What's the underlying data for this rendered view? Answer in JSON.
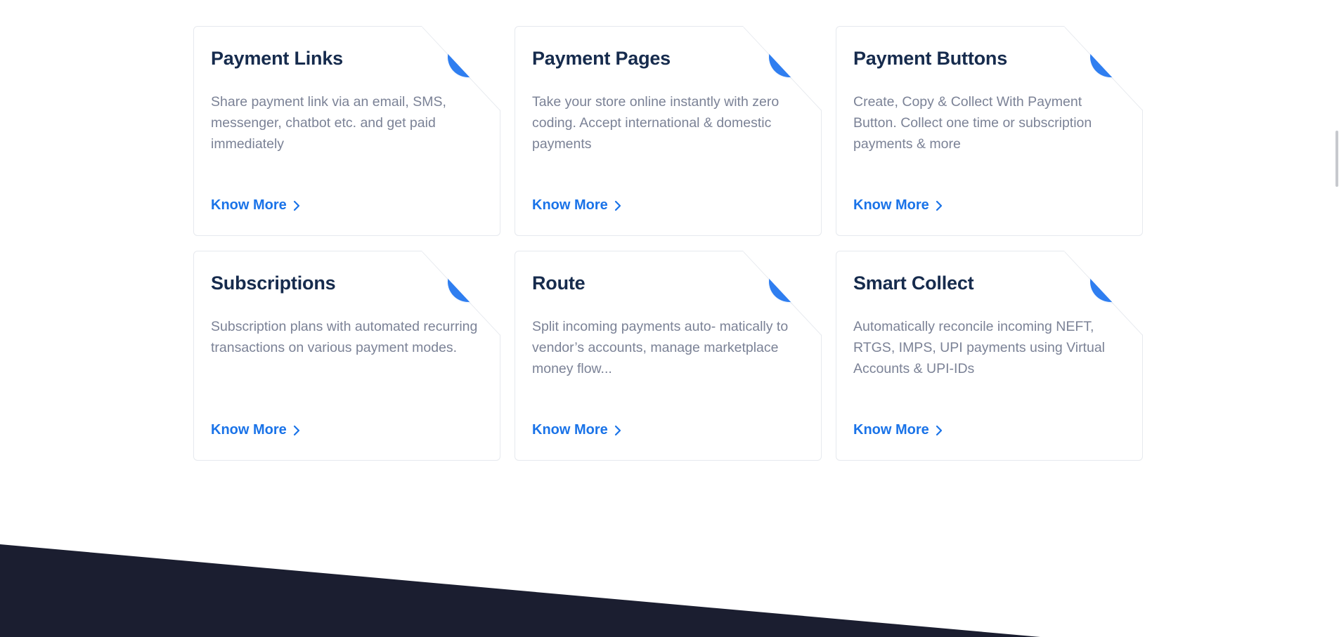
{
  "cards": [
    {
      "title": "Payment Links",
      "description": "Share payment link via an email, SMS, messenger, chatbot etc. and get paid immediately",
      "link_label": "Know More",
      "icon": "payment-links-icon"
    },
    {
      "title": "Payment Pages",
      "description": "Take your store online instantly with zero coding. Accept international & domestic payments",
      "link_label": "Know More",
      "icon": "payment-pages-icon"
    },
    {
      "title": "Payment Buttons",
      "description": "Create, Copy & Collect With Payment Button. Collect one time or subscription payments & more",
      "link_label": "Know More",
      "icon": "payment-buttons-icon"
    },
    {
      "title": "Subscriptions",
      "description": "Subscription plans with automated recurring transactions on various payment modes.",
      "link_label": "Know More",
      "icon": "rupee-refresh-icon"
    },
    {
      "title": "Route",
      "description": "Split incoming payments auto- matically to vendor’s accounts, manage marketplace money flow...",
      "link_label": "Know More",
      "icon": "route-split-icon"
    },
    {
      "title": "Smart Collect",
      "description": "Automatically reconcile incoming NEFT, RTGS, IMPS, UPI payments using Virtual Accounts & UPI-IDs",
      "link_label": "Know More",
      "icon": "shield-check-icon"
    }
  ],
  "colors": {
    "accent": "#2f7ef0",
    "link": "#1a73e8",
    "title": "#162b4d",
    "description": "#7b8296",
    "dark_band": "#1b1e30",
    "card_border": "#e6e9ee"
  }
}
